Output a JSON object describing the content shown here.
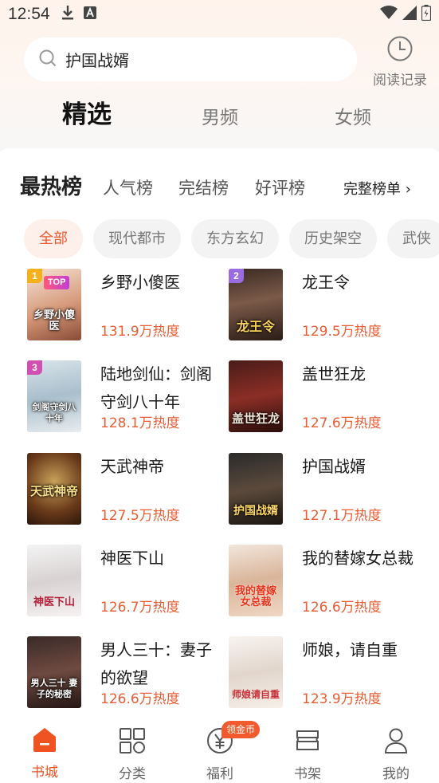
{
  "status_bar": {
    "time": "12:54"
  },
  "search": {
    "query": "护国战婿"
  },
  "history": {
    "label": "阅读记录"
  },
  "channel_tabs": [
    "精选",
    "男频",
    "女频"
  ],
  "rank_tabs": {
    "hot": "最热榜",
    "popular": "人气榜",
    "finished": "完结榜",
    "rated": "好评榜",
    "more": "完整榜单 ›"
  },
  "categories": [
    "全部",
    "现代都市",
    "东方玄幻",
    "历史架空",
    "武侠"
  ],
  "books": [
    {
      "rank": "1",
      "title": "乡野小傻医",
      "cover_text": "乡野小傻医",
      "heat": "131.9万热度",
      "top_tag": "TOP"
    },
    {
      "rank": "2",
      "title": "龙王令",
      "cover_text": "龙王令",
      "heat": "129.5万热度"
    },
    {
      "rank": "3",
      "title": "陆地剑仙：剑阁守剑八十年",
      "cover_text": "剑阁守剑八十年",
      "heat": "128.1万热度"
    },
    {
      "title": "盖世狂龙",
      "cover_text": "盖世狂龙",
      "heat": "127.6万热度"
    },
    {
      "title": "天武神帝",
      "cover_text": "天武神帝",
      "heat": "127.5万热度"
    },
    {
      "title": "护国战婿",
      "cover_text": "护国战婿",
      "heat": "127.1万热度"
    },
    {
      "title": "神医下山",
      "cover_text": "神医下山",
      "heat": "126.7万热度"
    },
    {
      "title": "我的替嫁女总裁",
      "cover_text": "我的替嫁女总裁",
      "heat": "126.6万热度"
    },
    {
      "title": "男人三十：妻子的欲望",
      "cover_text": "男人三十 妻子的秘密",
      "heat": "126.6万热度"
    },
    {
      "title": "师娘，请自重",
      "cover_text": "师娘请自重",
      "heat": "123.9万热度"
    }
  ],
  "bottom_nav": {
    "items": [
      "书城",
      "分类",
      "福利",
      "书架",
      "我的"
    ],
    "coin_badge": "领金币"
  },
  "colors": {
    "accent": "#ef5322",
    "heat": "#e95d35",
    "chip_active_bg": "#fdefe9"
  }
}
